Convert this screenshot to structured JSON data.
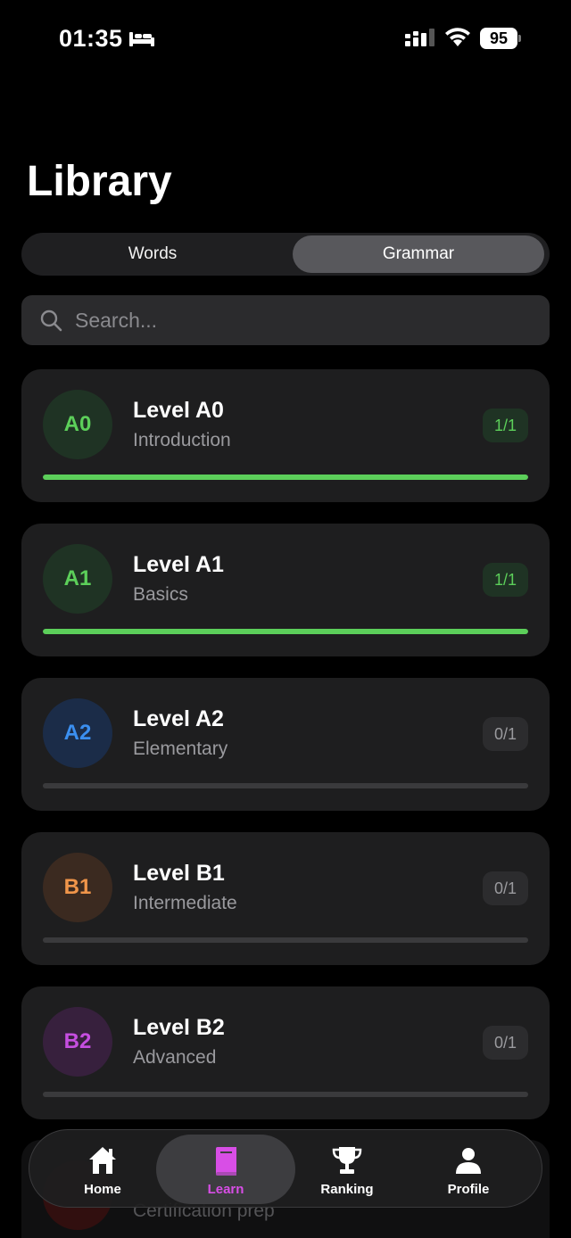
{
  "status_bar": {
    "time": "01:35",
    "battery": "95"
  },
  "page": {
    "title": "Library"
  },
  "segments": {
    "words": "Words",
    "grammar": "Grammar",
    "selected": "Grammar"
  },
  "search": {
    "placeholder": "Search..."
  },
  "levels": [
    {
      "badge": "A0",
      "title": "Level A0",
      "subtitle": "Introduction",
      "count": "1/1",
      "progress": 1.0,
      "badge_bg": "#1f3324",
      "badge_color": "#5ccf5a",
      "count_bg": "#1f3324",
      "count_color": "#5ccf5a"
    },
    {
      "badge": "A1",
      "title": "Level A1",
      "subtitle": "Basics",
      "count": "1/1",
      "progress": 1.0,
      "badge_bg": "#1f3324",
      "badge_color": "#5ccf5a",
      "count_bg": "#1f3324",
      "count_color": "#5ccf5a"
    },
    {
      "badge": "A2",
      "title": "Level A2",
      "subtitle": "Elementary",
      "count": "0/1",
      "progress": 0.0,
      "badge_bg": "#1b2c48",
      "badge_color": "#3b8ff0",
      "count_bg": "#2c2c2e",
      "count_color": "#9a9a9e"
    },
    {
      "badge": "B1",
      "title": "Level B1",
      "subtitle": "Intermediate",
      "count": "0/1",
      "progress": 0.0,
      "badge_bg": "#3b2a20",
      "badge_color": "#f0954a",
      "count_bg": "#2c2c2e",
      "count_color": "#9a9a9e"
    },
    {
      "badge": "B2",
      "title": "Level B2",
      "subtitle": "Advanced",
      "count": "0/1",
      "progress": 0.0,
      "badge_bg": "#37203d",
      "badge_color": "#c64ee0",
      "count_bg": "#2c2c2e",
      "count_color": "#9a9a9e"
    }
  ],
  "peek_card": {
    "subtitle": "Certification prep"
  },
  "tab_bar": {
    "home": "Home",
    "learn": "Learn",
    "ranking": "Ranking",
    "profile": "Profile",
    "active": "Learn",
    "active_color": "#d84ee6"
  }
}
